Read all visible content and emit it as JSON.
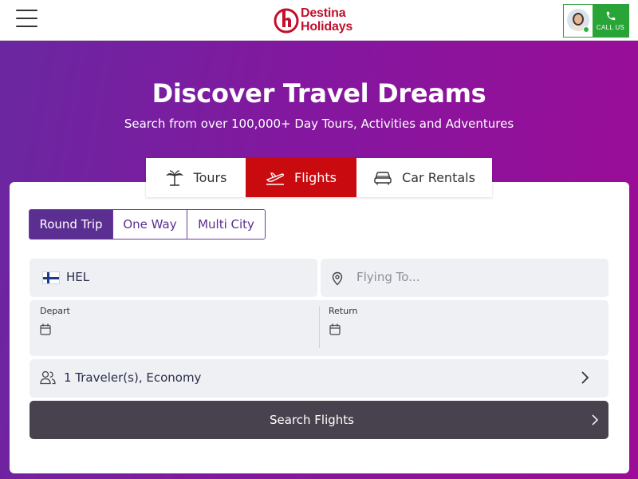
{
  "header": {
    "logo_line1": "Destina",
    "logo_line2": "Holidays",
    "call_label": "CALL US",
    "icons": [
      "hamburger-icon",
      "logo-icon",
      "agent-avatar",
      "phone-icon"
    ]
  },
  "hero": {
    "title": "Discover Travel Dreams",
    "subtitle": "Search from over 100,000+ Day Tours, Activities and Adventures"
  },
  "tabs": [
    {
      "label": "Tours",
      "icon": "palm-tree-icon",
      "active": false
    },
    {
      "label": "Flights",
      "icon": "plane-icon",
      "active": true
    },
    {
      "label": "Car Rentals",
      "icon": "car-icon",
      "active": false
    }
  ],
  "trip_types": [
    {
      "label": "Round Trip",
      "active": true
    },
    {
      "label": "One Way",
      "active": false
    },
    {
      "label": "Multi City",
      "active": false
    }
  ],
  "search": {
    "from_value": "HEL",
    "to_placeholder": "Flying To...",
    "depart_label": "Depart",
    "return_label": "Return",
    "travelers": "1 Traveler(s), Economy",
    "submit_label": "Search Flights"
  },
  "colors": {
    "brand_red": "#c0102c",
    "active_tab": "#c90a0e",
    "purple": "#5b2e91",
    "call_green": "#27a536",
    "search_button": "#48424f"
  }
}
